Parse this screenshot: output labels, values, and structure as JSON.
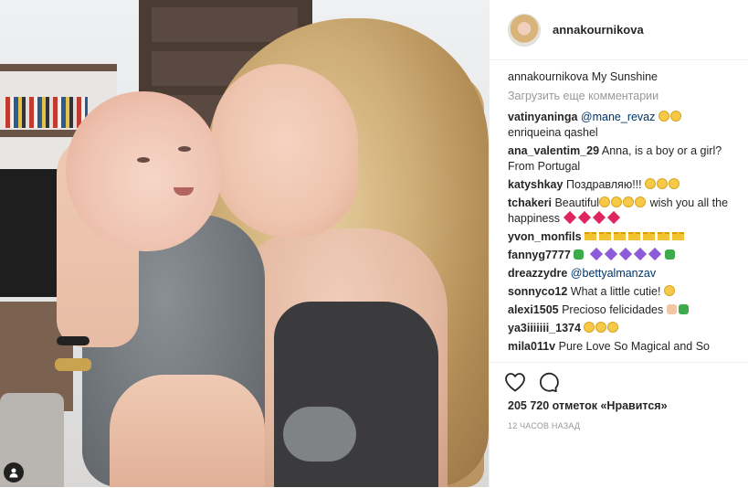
{
  "post": {
    "username": "annakournikova",
    "caption_user": "annakournikova",
    "caption_text": "My Sunshine",
    "load_more": "Загрузить еще комментарии",
    "likes": "205 720 отметок «Нравится»",
    "time": "12 часов назад"
  },
  "comments": [
    {
      "user": "vatinyaninga",
      "mention": "@mane_revaz",
      "text_after": "",
      "emoji": [
        "face",
        "face"
      ],
      "line2": "enriqueina qashel"
    },
    {
      "user": "ana_valentim_29",
      "text": "Anna, is a boy or a girl? From Portugal"
    },
    {
      "user": "katyshkay",
      "text": "Поздравляю!!!",
      "emoji": [
        "face",
        "face",
        "face"
      ]
    },
    {
      "user": "tchakeri",
      "text": "Beautiful",
      "text_after": "wish you all the happiness"
    },
    {
      "user": "yvon_monfils",
      "text": ""
    },
    {
      "user": "fannyg7777",
      "text": ""
    },
    {
      "user": "dreazzydre",
      "mention": "@bettyalmanzav"
    },
    {
      "user": "sonnyco12",
      "text": "What a little cutie!"
    },
    {
      "user": "alexi1505",
      "text": "Precioso felicidades"
    },
    {
      "user": "ya3iiiiiii_1374",
      "text": ""
    },
    {
      "user": "mila011v",
      "text": "Pure Love So Magical and So"
    }
  ],
  "icons": [
    "heart-icon",
    "comment-icon",
    "user-tag-icon"
  ],
  "colors": {
    "mention": "#003569",
    "muted": "#999999",
    "text": "#262626"
  }
}
